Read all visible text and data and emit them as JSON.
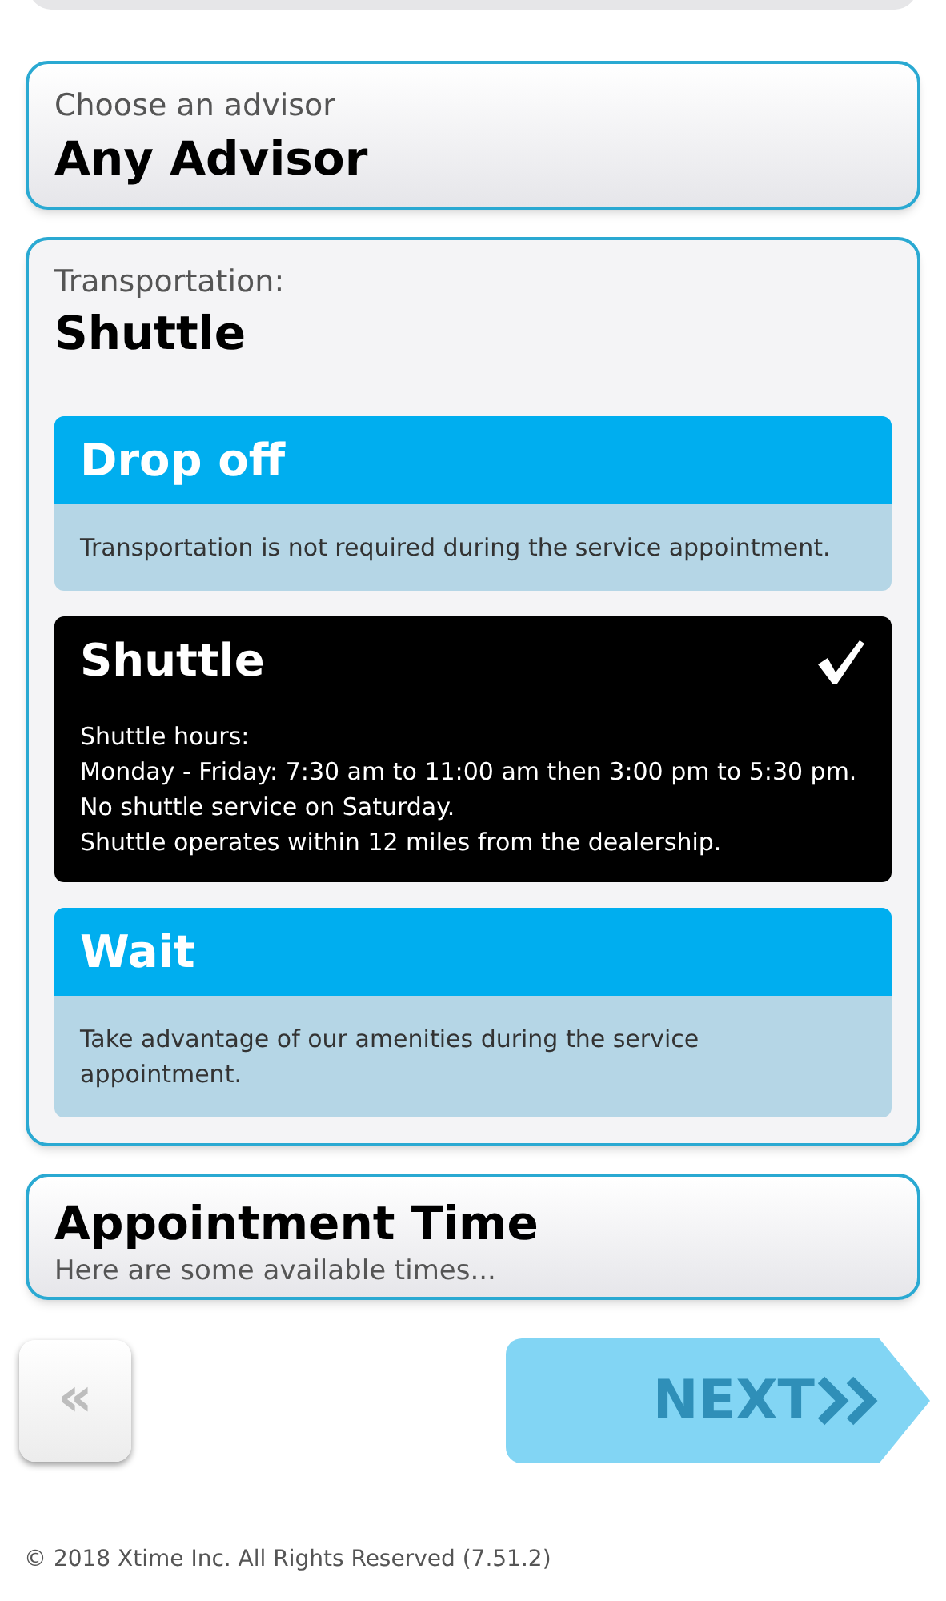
{
  "advisor": {
    "label": "Choose an advisor",
    "value": "Any Advisor"
  },
  "transportation": {
    "label": "Transportation:",
    "value": "Shuttle",
    "options": [
      {
        "title": "Drop off",
        "selected": false,
        "description": [
          "Transportation is not required during the service appointment."
        ]
      },
      {
        "title": "Shuttle",
        "selected": true,
        "description": [
          "Shuttle hours:",
          "Monday - Friday: 7:30 am to 11:00 am then 3:00 pm to 5:30 pm.",
          "No shuttle service on Saturday.",
          "Shuttle operates within 12 miles from the dealership."
        ]
      },
      {
        "title": "Wait",
        "selected": false,
        "description": [
          "Take advantage of our amenities during the service appointment."
        ]
      }
    ]
  },
  "appointment": {
    "title": "Appointment Time",
    "subtitle": "Here are some available times..."
  },
  "back_button": {
    "label": "«"
  },
  "next_button": {
    "label": "NEXT",
    "disabled": true
  },
  "footer": "© 2018 Xtime Inc. All Rights Reserved (7.51.2)"
}
